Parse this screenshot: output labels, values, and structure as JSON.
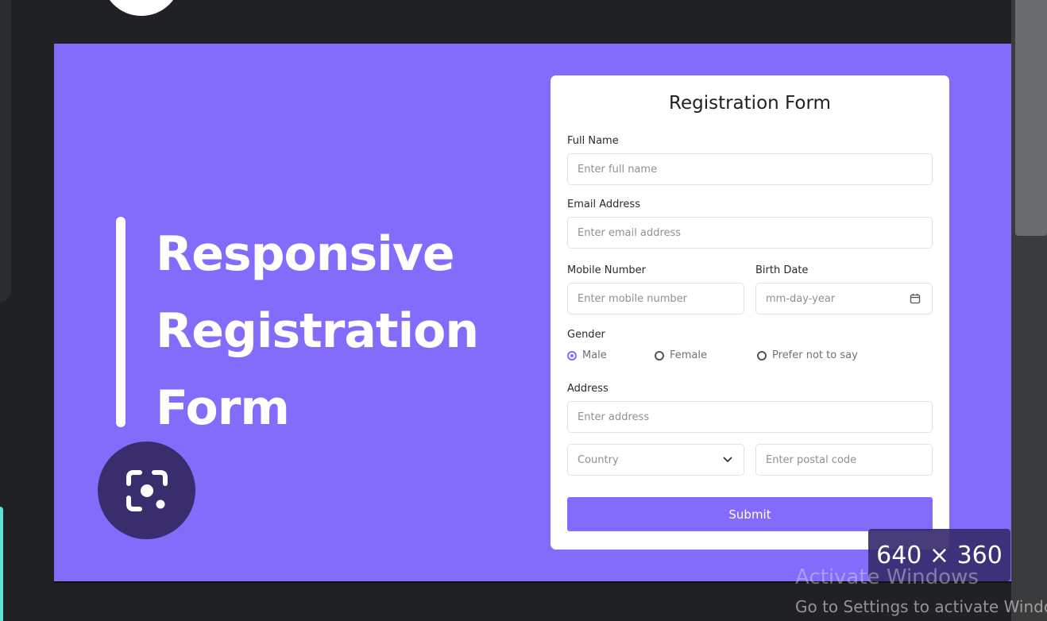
{
  "banner": {
    "hero_lines": [
      "Responsive",
      "Registration",
      "Form"
    ]
  },
  "form": {
    "title": "Registration Form",
    "full_name": {
      "label": "Full Name",
      "placeholder": "Enter full name"
    },
    "email": {
      "label": "Email Address",
      "placeholder": "Enter email address"
    },
    "mobile": {
      "label": "Mobile Number",
      "placeholder": "Enter mobile number"
    },
    "birth_date": {
      "label": "Birth Date",
      "placeholder": "mm-day-year"
    },
    "gender": {
      "label": "Gender",
      "options": [
        "Male",
        "Female",
        "Prefer not to say"
      ],
      "selected": "Male"
    },
    "address": {
      "label": "Address",
      "placeholder": "Enter address"
    },
    "country": {
      "value": "Country"
    },
    "postal": {
      "placeholder": "Enter postal code"
    },
    "submit_label": "Submit"
  },
  "overlay": {
    "image_size": "640 × 360",
    "activate_title": "Activate Windows",
    "activate_sub": "Go to Settings to activate Windows."
  },
  "colors": {
    "accent": "#836cfb",
    "lens_button": "#3a2d6e",
    "background": "#202124"
  },
  "icons": [
    "calendar-icon",
    "chevron-down-icon",
    "camera-lens-icon"
  ]
}
